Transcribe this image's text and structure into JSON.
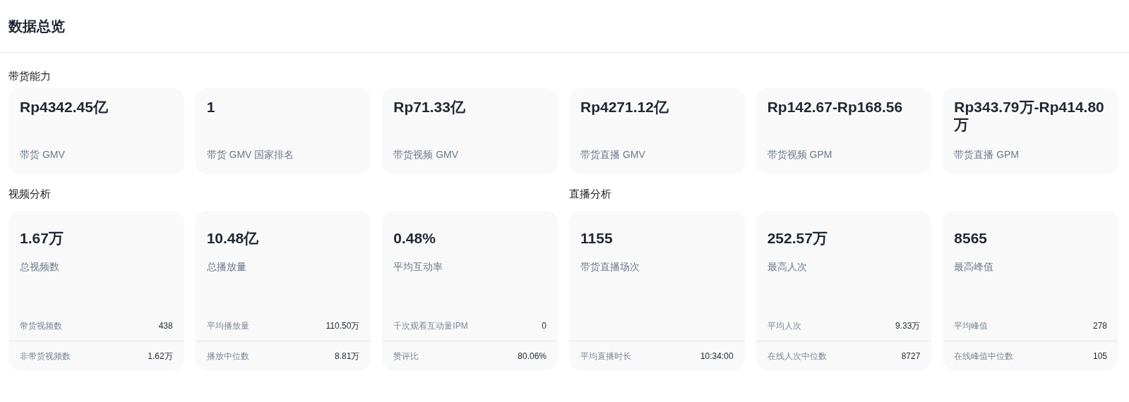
{
  "page_title": "数据总览",
  "sales": {
    "title": "带货能力",
    "cards": [
      {
        "value": "Rp4342.45亿",
        "label": "带货 GMV"
      },
      {
        "value": "1",
        "label": "带货 GMV 国家排名"
      },
      {
        "value": "Rp71.33亿",
        "label": "带货视频 GMV"
      },
      {
        "value": "Rp4271.12亿",
        "label": "带货直播 GMV"
      },
      {
        "value": "Rp142.67-Rp168.56",
        "label": "带货视频 GPM"
      },
      {
        "value": "Rp343.79万-Rp414.80万",
        "label": "带货直播 GPM"
      }
    ]
  },
  "sections": [
    {
      "title": "视频分析",
      "cards": [
        {
          "value": "1.67万",
          "label": "总视频数",
          "rows": [
            {
              "label": "带货视频数",
              "value": "438"
            },
            {
              "label": "非带货视频数",
              "value": "1.62万"
            }
          ]
        },
        {
          "value": "10.48亿",
          "label": "总播放量",
          "rows": [
            {
              "label": "平均播放量",
              "value": "110.50万"
            },
            {
              "label": "播放中位数",
              "value": "8.81万"
            }
          ]
        },
        {
          "value": "0.48%",
          "label": "平均互动率",
          "rows": [
            {
              "label": "千次观看互动量IPM",
              "value": "0"
            },
            {
              "label": "赞评比",
              "value": "80.06%"
            }
          ]
        }
      ]
    },
    {
      "title": "直播分析",
      "cards": [
        {
          "value": "1155",
          "label": "带货直播场次",
          "rows": [
            {
              "label": "平均直播时长",
              "value": "10:34:00"
            }
          ]
        },
        {
          "value": "252.57万",
          "label": "最高人次",
          "rows": [
            {
              "label": "平均人次",
              "value": "9.33万"
            },
            {
              "label": "在线人次中位数",
              "value": "8727"
            }
          ]
        },
        {
          "value": "8565",
          "label": "最高峰值",
          "rows": [
            {
              "label": "平均峰值",
              "value": "278"
            },
            {
              "label": "在线峰值中位数",
              "value": "105"
            }
          ]
        }
      ]
    }
  ]
}
